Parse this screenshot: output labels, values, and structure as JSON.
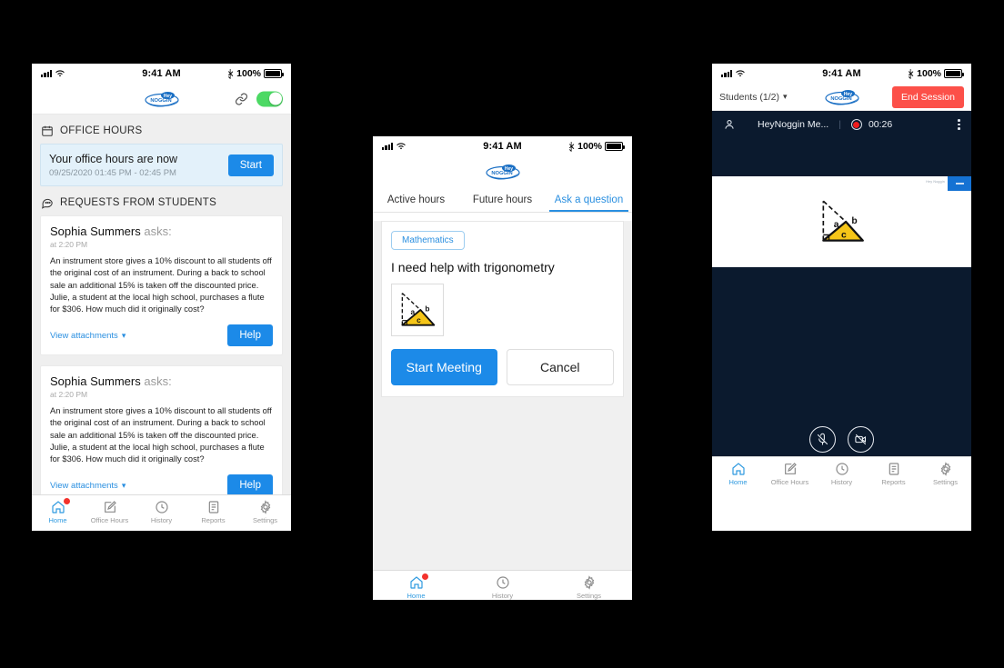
{
  "brand": {
    "name": "HeyNoggin",
    "logo_top": "Hey",
    "logo_bottom": "NOGGIN",
    "accent_blue": "#1c8ae8",
    "accent_red": "#fc5049",
    "dark_navy": "#0b1a2e"
  },
  "status_bar": {
    "time": "9:41 AM",
    "battery": "100%",
    "bluetooth_icon": "bluetooth-icon",
    "signal_icon": "signal-bars-icon",
    "wifi_icon": "wifi-icon"
  },
  "phone1": {
    "appbar": {
      "link_icon": "link-icon",
      "toggle_state": "on"
    },
    "office_hours": {
      "section_label": "OFFICE HOURS",
      "section_icon": "calendar-icon",
      "title": "Your office hours are now",
      "subtitle": "09/25/2020 01:45 PM - 02:45 PM",
      "start_label": "Start"
    },
    "requests": {
      "section_label": "REQUESTS FROM STUDENTS",
      "section_icon": "chat-bubble-icon",
      "items": [
        {
          "student": "Sophia Summers",
          "asks": "asks:",
          "time": "at 2:20 PM",
          "question": "An instrument store gives a 10% discount to all students off the original cost of an instrument. During a back to school sale an additional 15% is taken off the discounted price. Julie, a student at the local high school, purchases a flute for $306. How much did it originally cost?",
          "attachments_label": "View attachments",
          "help_label": "Help"
        },
        {
          "student": "Sophia Summers",
          "asks": "asks:",
          "time": "at 2:20 PM",
          "question": "An instrument store gives a 10% discount to all students off the original cost of an instrument. During a back to school sale an additional 15% is taken off the discounted price. Julie, a student at the local high school, purchases a flute for $306. How much did it originally cost?",
          "attachments_label": "View attachments",
          "help_label": "Help"
        }
      ]
    },
    "tabbar": [
      {
        "label": "Home",
        "icon": "home-icon",
        "active": true,
        "badge": true
      },
      {
        "label": "Office Hours",
        "icon": "edit-square-icon",
        "active": false,
        "badge": false
      },
      {
        "label": "History",
        "icon": "clock-icon",
        "active": false,
        "badge": false
      },
      {
        "label": "Reports",
        "icon": "document-icon",
        "active": false,
        "badge": false
      },
      {
        "label": "Settings",
        "icon": "gear-icon",
        "active": false,
        "badge": false
      }
    ]
  },
  "phone2": {
    "tabs": [
      {
        "label": "Active hours",
        "active": false
      },
      {
        "label": "Future hours",
        "active": false
      },
      {
        "label": "Ask a question",
        "active": true
      }
    ],
    "modal": {
      "subject_chip": "Mathematics",
      "question": "I need help with trigonometry",
      "attachment_alt": "triangle-diagram-thumbnail",
      "triangle_labels": [
        "a",
        "b",
        "c"
      ],
      "primary_label": "Start Meeting",
      "secondary_label": "Cancel"
    },
    "tabbar": [
      {
        "label": "Home",
        "icon": "home-icon",
        "active": true,
        "badge": true
      },
      {
        "label": "History",
        "icon": "clock-icon",
        "active": false,
        "badge": false
      },
      {
        "label": "Settings",
        "icon": "gear-icon",
        "active": false,
        "badge": false
      }
    ]
  },
  "phone3": {
    "appbar": {
      "students_label": "Students (1/2)",
      "chevron": "chevron-down-icon",
      "end_session_label": "End Session"
    },
    "session": {
      "participant_icon": "person-icon",
      "meeting_title": "HeyNoggin Me...",
      "separator": "|",
      "recording_icon": "record-dot-icon",
      "timer": "00:26",
      "more_icon": "kebab-menu-icon",
      "whiteboard_minimize_icon": "minimize-icon",
      "whiteboard_tiny_text": "Hey Noggin",
      "triangle_labels": [
        "a",
        "b",
        "c"
      ],
      "controls": [
        {
          "name": "mic-off-icon",
          "label": "Mute microphone"
        },
        {
          "name": "camera-off-icon",
          "label": "Turn off camera"
        }
      ]
    },
    "tabbar": [
      {
        "label": "Home",
        "icon": "home-icon",
        "active": true,
        "badge": false
      },
      {
        "label": "Office Hours",
        "icon": "edit-square-icon",
        "active": false,
        "badge": false
      },
      {
        "label": "History",
        "icon": "clock-icon",
        "active": false,
        "badge": false
      },
      {
        "label": "Reports",
        "icon": "document-icon",
        "active": false,
        "badge": false
      },
      {
        "label": "Settings",
        "icon": "gear-icon",
        "active": false,
        "badge": false
      }
    ]
  }
}
